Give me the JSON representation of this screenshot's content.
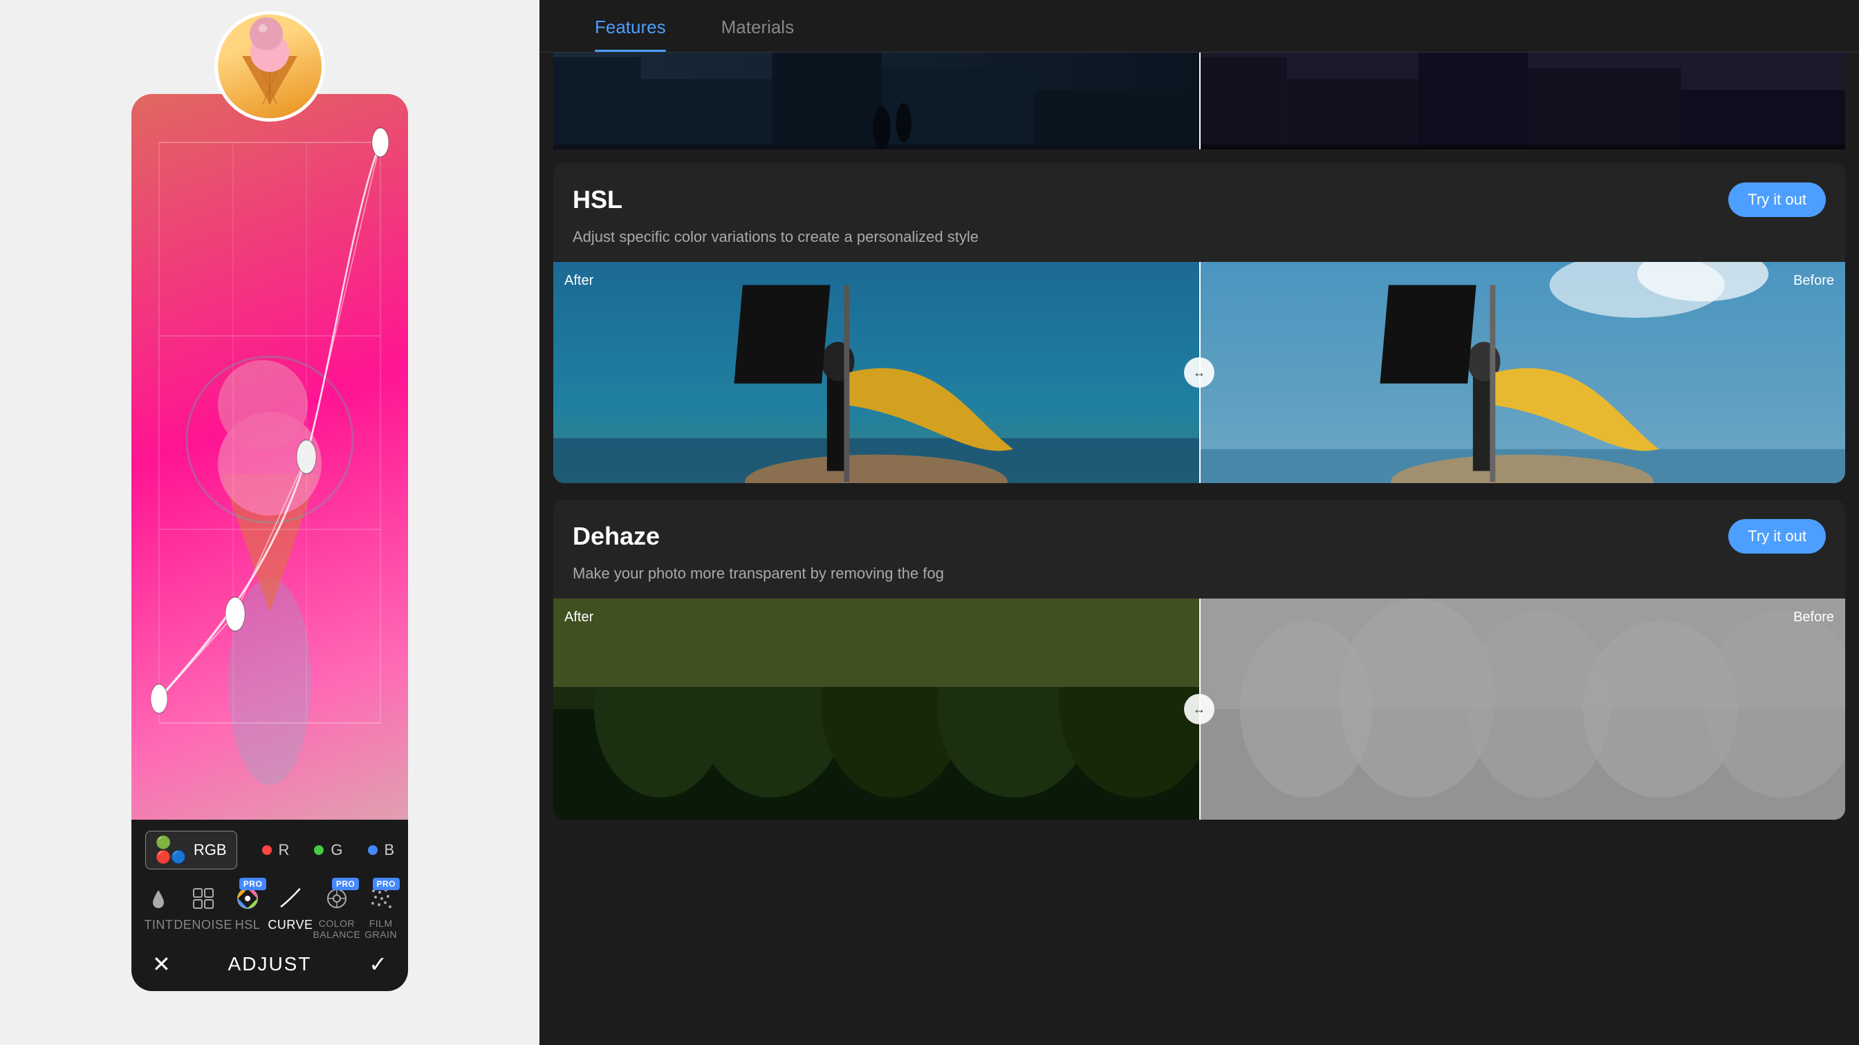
{
  "left": {
    "toolbar": {
      "rgb_label": "RGB",
      "channels": [
        {
          "dot_color": "#ff4444",
          "label": "R"
        },
        {
          "dot_color": "#44cc44",
          "label": "G"
        },
        {
          "dot_color": "#4488ff",
          "label": "B"
        }
      ],
      "tools": [
        {
          "icon": "💧",
          "label": "TINT",
          "active": false,
          "pro": false
        },
        {
          "icon": "▦",
          "label": "DENOISE",
          "active": false,
          "pro": false
        },
        {
          "icon": "✦",
          "label": "HSL",
          "active": false,
          "pro": true
        },
        {
          "icon": "📈",
          "label": "CURVE",
          "active": true,
          "pro": false
        },
        {
          "icon": "⚙",
          "label": "COLOR BALANCE",
          "active": false,
          "pro": true
        },
        {
          "icon": "⋮⋮",
          "label": "FILM GRAIN",
          "active": false,
          "pro": true
        }
      ],
      "bottom_nav": {
        "cancel": "✕",
        "title": "ADJUST",
        "confirm": "✓"
      }
    }
  },
  "right": {
    "tabs": [
      {
        "label": "Features",
        "active": true
      },
      {
        "label": "Materials",
        "active": false
      }
    ],
    "features": [
      {
        "title": "HSL",
        "try_label": "Try it out",
        "description": "Adjust specific color variations to create a\npersonalized style",
        "after_label": "After",
        "before_label": "Before"
      },
      {
        "title": "Dehaze",
        "try_label": "Try it out",
        "description": "Make your photo more transparent by removing the fog",
        "after_label": "After",
        "before_label": "Before"
      }
    ]
  }
}
